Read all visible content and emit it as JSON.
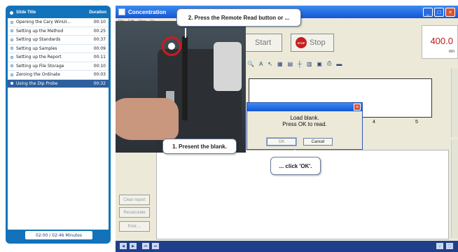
{
  "slides": {
    "header_title": "Slide Title",
    "header_duration": "Duration",
    "items": [
      {
        "title": "Opening the Cary WinUI...",
        "duration": "00:10"
      },
      {
        "title": "Setting up the Method",
        "duration": "00:25"
      },
      {
        "title": "Setting up Standards",
        "duration": "00:37"
      },
      {
        "title": "Setting up Samples",
        "duration": "00:09"
      },
      {
        "title": "Setting up the Report",
        "duration": "00:11"
      },
      {
        "title": "Setting up File Storage",
        "duration": "00:10"
      },
      {
        "title": "Zeroing the Ordinate",
        "duration": "00:03"
      },
      {
        "title": "Using the Dip Probe",
        "duration": "00:32"
      }
    ],
    "footer": "02:00 / 02:46 Minutes"
  },
  "app": {
    "title": "Concentration",
    "menu": [
      "File",
      "Edit",
      "View",
      "Co..."
    ],
    "start_label": "Start",
    "stop_label": "Stop",
    "stop_sign_text": "STOP",
    "readout_value": "400.0",
    "readout_unit": "nm",
    "x_ticks": [
      "4",
      "5"
    ],
    "side_buttons": {
      "clear": "Clear report",
      "recalc": "Recalculate",
      "print": "Print ..."
    }
  },
  "dialog": {
    "line1": "Load blank.",
    "line2": "Press OK to read.",
    "ok": "OK",
    "cancel": "Cancel"
  },
  "callouts": {
    "step2": "2. Press the Remote Read button or ...",
    "step1": "1. Present the blank.",
    "click_ok": "... click 'OK'."
  }
}
